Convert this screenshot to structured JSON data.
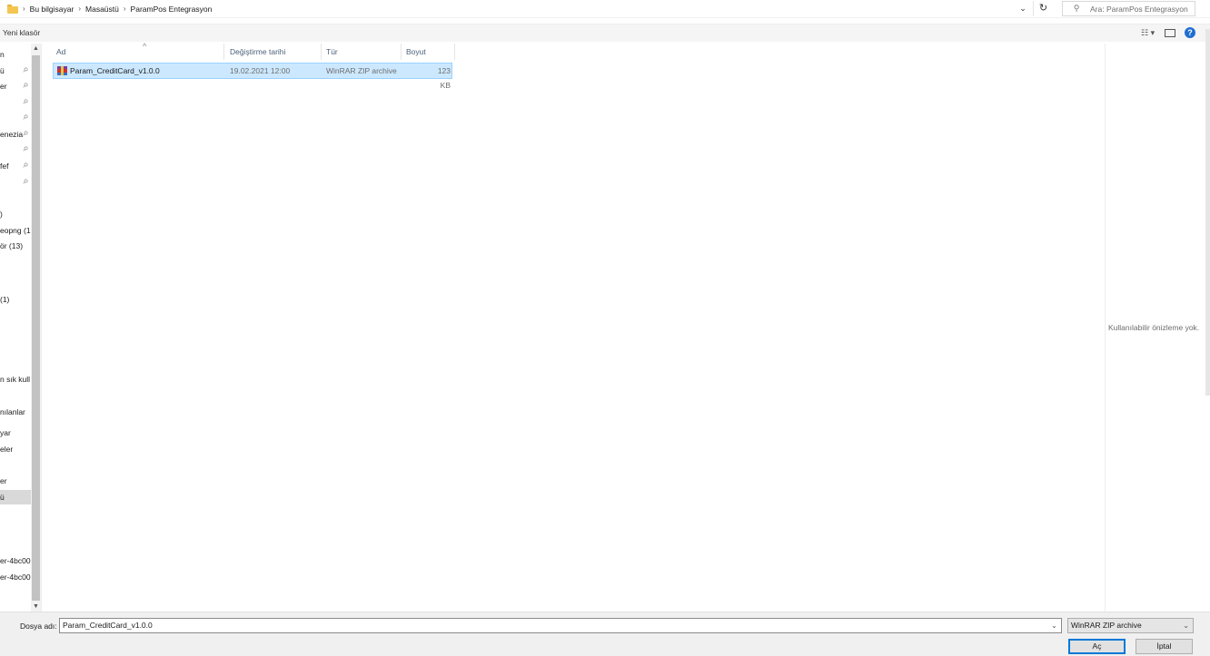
{
  "address": {
    "breadcrumbs": [
      "Bu bilgisayar",
      "Masaüstü",
      "ParamPos Entegrasyon"
    ],
    "separator": "›",
    "search_placeholder": "Ara: ParamPos Entegrasyon"
  },
  "toolbar": {
    "new_folder_label": "Yeni klasör"
  },
  "nav": {
    "items": [
      {
        "label": "n",
        "pinned": false
      },
      {
        "label": "ü",
        "pinned": true
      },
      {
        "label": "er",
        "pinned": true
      },
      {
        "label": "",
        "pinned": true
      },
      {
        "label": "",
        "pinned": true
      },
      {
        "label": "enezia",
        "pinned": true
      },
      {
        "label": "",
        "pinned": true
      },
      {
        "label": "fef",
        "pinned": true
      },
      {
        "label": "",
        "pinned": true
      },
      {
        "label": ")",
        "pinned": false
      },
      {
        "label": "eopng (1",
        "pinned": false
      },
      {
        "label": "ör (13)",
        "pinned": false
      },
      {
        "label": "(1)",
        "pinned": false
      },
      {
        "label": "n sık kull",
        "pinned": false
      },
      {
        "label": "nılanlar",
        "pinned": false
      },
      {
        "label": "yar",
        "pinned": false
      },
      {
        "label": "eler",
        "pinned": false
      },
      {
        "label": "er",
        "pinned": false
      },
      {
        "label": "ü",
        "pinned": false,
        "selected": true
      },
      {
        "label": "er-4bc00",
        "pinned": false
      },
      {
        "label": "er-4bc00",
        "pinned": false
      }
    ]
  },
  "file_list": {
    "columns": [
      "Ad",
      "Değiştirme tarihi",
      "Tür",
      "Boyut"
    ],
    "rows": [
      {
        "name": "Param_CreditCard_v1.0.0",
        "modified": "19.02.2021 12:00",
        "type": "WinRAR ZIP archive",
        "size": "123 KB"
      }
    ]
  },
  "preview": {
    "message": "Kullanılabilir önizleme yok."
  },
  "footer": {
    "filename_label": "Dosya adı:",
    "filename_value": "Param_CreditCard_v1.0.0",
    "filetype_value": "WinRAR ZIP archive",
    "open_label": "Aç",
    "cancel_label": "İptal"
  },
  "icons": {
    "folder": "folder-icon",
    "refresh": "refresh-icon",
    "search": "search-icon",
    "help": "help-icon",
    "pin": "pin-icon",
    "archive": "winrar-archive-icon"
  },
  "colors": {
    "selection_fill": "#cce8ff",
    "selection_border": "#99d1ff",
    "primary_button_border": "#0078d7",
    "help_blue": "#1f6fd1",
    "column_header_text": "#4c607a"
  }
}
